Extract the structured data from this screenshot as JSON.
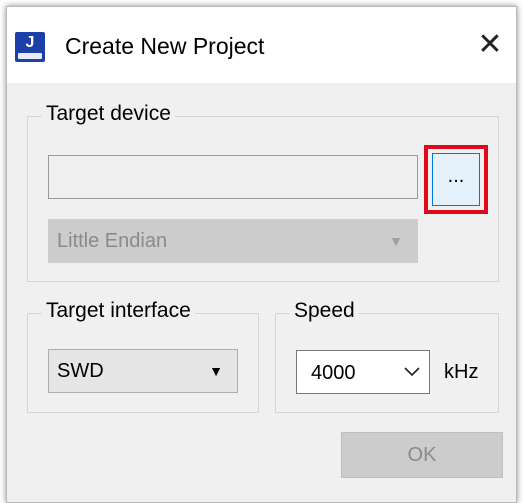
{
  "window": {
    "title": "Create New Project",
    "icon": "segger-j-link-icon",
    "close_glyph": "✕"
  },
  "target_device": {
    "group_label": "Target device",
    "device_value": "",
    "browse_label": "...",
    "endian_value": "Little Endian"
  },
  "target_interface": {
    "group_label": "Target interface",
    "selected": "SWD"
  },
  "speed": {
    "group_label": "Speed",
    "value": "4000",
    "unit": "kHz"
  },
  "actions": {
    "ok_label": "OK"
  },
  "colors": {
    "highlight": "#e0081b",
    "accent": "#0078d7",
    "disabled_text": "#8a8a8a"
  }
}
